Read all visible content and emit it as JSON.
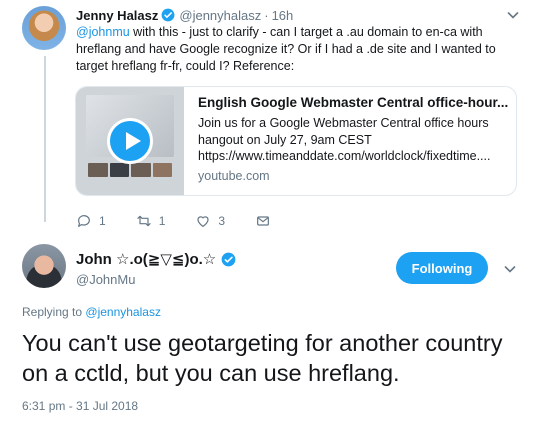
{
  "parent_tweet": {
    "author_name": "Jenny Halasz",
    "author_handle": "@jennyhalasz",
    "time": "16h",
    "text_mention": "@johnmu",
    "text_body": " with this - just to clarify - can I target a .au domain to en-ca with hreflang and have Google recognize it? Or if I had a .de site and I wanted to target hreflang fr-fr, could I? Reference:",
    "card": {
      "title": "English Google Webmaster Central office-hour...",
      "desc_line1": "Join us for a Google Webmaster Central office hours",
      "desc_line2": "hangout on July 27, 9am CEST",
      "desc_line3": "https://www.timeanddate.com/worldclock/fixedtime....",
      "domain": "youtube.com"
    },
    "actions": {
      "reply_count": "1",
      "retweet_count": "1",
      "like_count": "3"
    }
  },
  "main_tweet": {
    "author_name": "John ☆.o(≧▽≦)o.☆",
    "author_handle": "@JohnMu",
    "follow_label": "Following",
    "replying_prefix": "Replying to",
    "replying_handle": "@jennyhalasz",
    "text": "You can't use geotargeting for another country on a cctld, but you can use hreflang.",
    "timestamp": "6:31 pm - 31 Jul 2018"
  },
  "colors": {
    "accent": "#1da1f2",
    "muted": "#657786",
    "border": "#e1e8ed"
  },
  "icons": [
    "verified-icon",
    "chevron-down-icon",
    "reply-icon",
    "retweet-icon",
    "like-icon",
    "direct-message-icon",
    "play-icon"
  ]
}
